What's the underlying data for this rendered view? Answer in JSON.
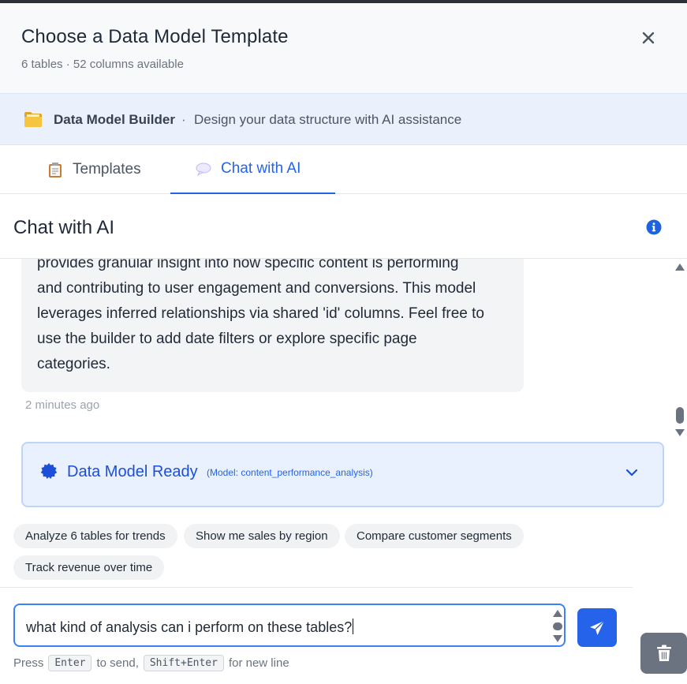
{
  "header": {
    "title": "Choose a Data Model Template",
    "subtitle": "6 tables · 52 columns available",
    "close_icon": "close-icon"
  },
  "banner": {
    "icon": "folder-icon",
    "name": "Data Model Builder",
    "separator": "·",
    "description": "Design your data structure with AI assistance"
  },
  "tabs": [
    {
      "label": "Templates",
      "icon": "clipboard-icon",
      "active": false
    },
    {
      "label": "Chat with AI",
      "icon": "speech-bubble-icon",
      "active": true
    }
  ],
  "chat": {
    "title": "Chat with AI",
    "info_icon": "info-icon",
    "message": {
      "lines": [
        "provides granular insight into how specific content is performing",
        "and contributing to user engagement and conversions. This model",
        "leverages inferred relationships via shared 'id' columns. Feel free to",
        "use the builder to add date filters or explore specific page",
        "categories."
      ],
      "timestamp": "2 minutes ago"
    },
    "ready_card": {
      "title": "Data Model Ready",
      "model": "(Model: content_performance_analysis)"
    }
  },
  "suggestions": [
    "Analyze 6 tables for trends",
    "Show me sales by region",
    "Compare customer segments",
    "Track revenue over time"
  ],
  "composer": {
    "value": "what kind of analysis can i perform on these tables?",
    "hint_press": "Press",
    "hint_key1": "Enter",
    "hint_to_send": "to send,",
    "hint_key2": "Shift+Enter",
    "hint_new_line": "for new line"
  },
  "colors": {
    "accent": "#2563eb",
    "banner_bg": "#eaf1fc",
    "card_bg": "#e8f1fd",
    "trash_bg": "#6b7280"
  }
}
